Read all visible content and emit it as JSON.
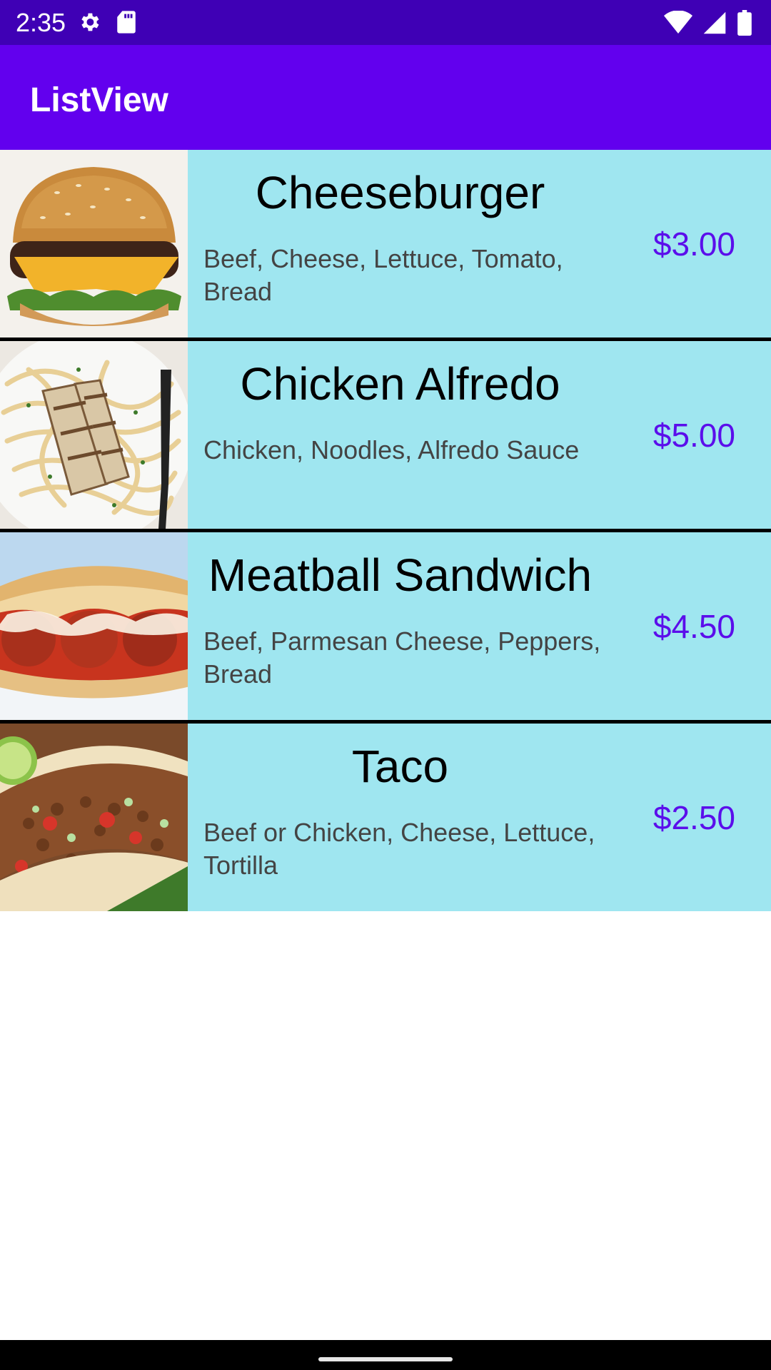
{
  "status_bar": {
    "time": "2:35",
    "left_icons": [
      "gear-icon",
      "sd-card-icon"
    ],
    "right_icons": [
      "wifi-icon",
      "signal-icon",
      "battery-icon"
    ]
  },
  "app_bar": {
    "title": "ListView"
  },
  "colors": {
    "status_bar": "#3F00B5",
    "app_bar": "#6200EE",
    "row_background": "#9FE6F0",
    "price_text": "#5B0EEB",
    "description_text": "#444444"
  },
  "items": [
    {
      "title": "Cheeseburger",
      "description": "Beef, Cheese, Lettuce, Tomato, Bread",
      "price": "$3.00",
      "image": "cheeseburger-photo"
    },
    {
      "title": "Chicken Alfredo",
      "description": "Chicken, Noodles, Alfredo Sauce",
      "price": "$5.00",
      "image": "chicken-alfredo-photo"
    },
    {
      "title": "Meatball Sandwich",
      "description": "Beef, Parmesan Cheese, Peppers, Bread",
      "price": "$4.50",
      "image": "meatball-sandwich-photo"
    },
    {
      "title": "Taco",
      "description": "Beef or Chicken, Cheese, Lettuce, Tortilla",
      "price": "$2.50",
      "image": "taco-photo"
    }
  ]
}
